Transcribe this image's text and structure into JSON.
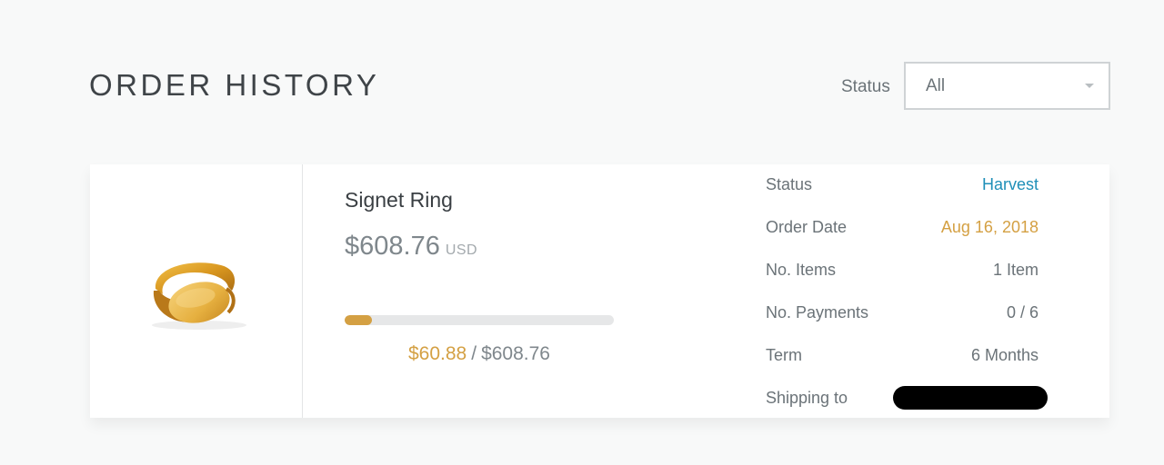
{
  "header": {
    "title": "ORDER HISTORY",
    "filter_label": "Status",
    "filter_value": "All"
  },
  "order": {
    "product_name": "Signet Ring",
    "price": "$608.76",
    "currency": "USD",
    "progress_fraction": 0.1,
    "paid_amount": "$60.88",
    "separator": "/",
    "total_amount": "$608.76",
    "details": [
      {
        "label": "Status",
        "value": "Harvest"
      },
      {
        "label": "Order Date",
        "value": "Aug 16, 2018"
      },
      {
        "label": "No. Items",
        "value": "1 Item"
      },
      {
        "label": "No. Payments",
        "value": "0 / 6"
      },
      {
        "label": "Term",
        "value": "6 Months"
      },
      {
        "label": "Shipping to",
        "value": ""
      }
    ]
  },
  "colors": {
    "accent_gold": "#d4a043",
    "status_blue": "#1f8fb8",
    "text_gray": "#6b7378"
  },
  "icons": {
    "dropdown": "chevron-down-icon",
    "product_image": "signet-ring-image"
  }
}
